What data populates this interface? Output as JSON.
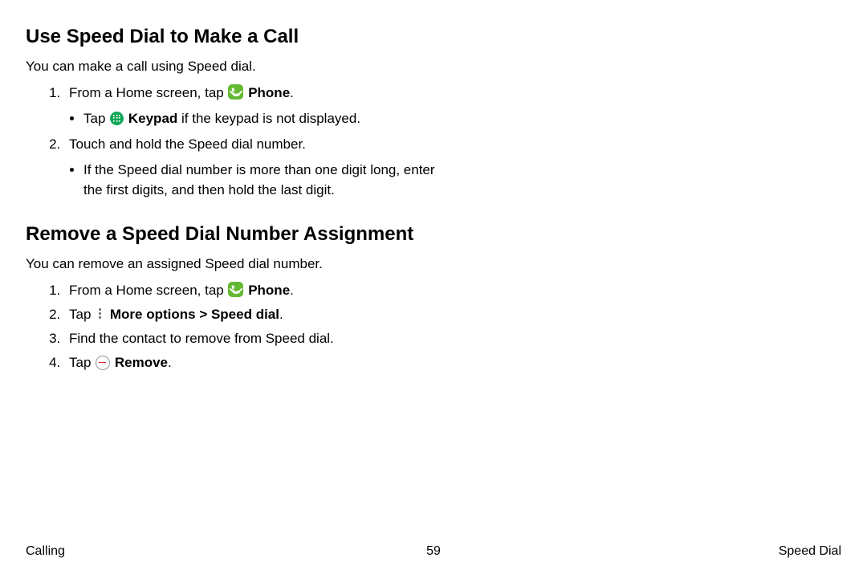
{
  "section1": {
    "title": "Use Speed Dial to Make a Call",
    "intro": "You can make a call using Speed dial.",
    "step1_pre": "From a Home screen, tap ",
    "step1_bold": "Phone",
    "step1_post": ".",
    "step1_bullet_pre": "Tap ",
    "step1_bullet_bold": "Keypad",
    "step1_bullet_post": " if the keypad is not displayed.",
    "step2": "Touch and hold the Speed dial number.",
    "step2_bullet": "If the Speed dial number is more than one digit long, enter the first digits, and then hold the last digit."
  },
  "section2": {
    "title": "Remove a Speed Dial Number Assignment",
    "intro": "You can remove an assigned Speed dial number.",
    "step1_pre": "From a Home screen, tap ",
    "step1_bold": "Phone",
    "step1_post": ".",
    "step2_pre": "Tap ",
    "step2_bold": "More options > Speed dial",
    "step2_post": ".",
    "step3": "Find the contact to remove from Speed dial.",
    "step4_pre": "Tap ",
    "step4_bold": "Remove",
    "step4_post": "."
  },
  "footer": {
    "left": "Calling",
    "center": "59",
    "right": "Speed Dial"
  }
}
